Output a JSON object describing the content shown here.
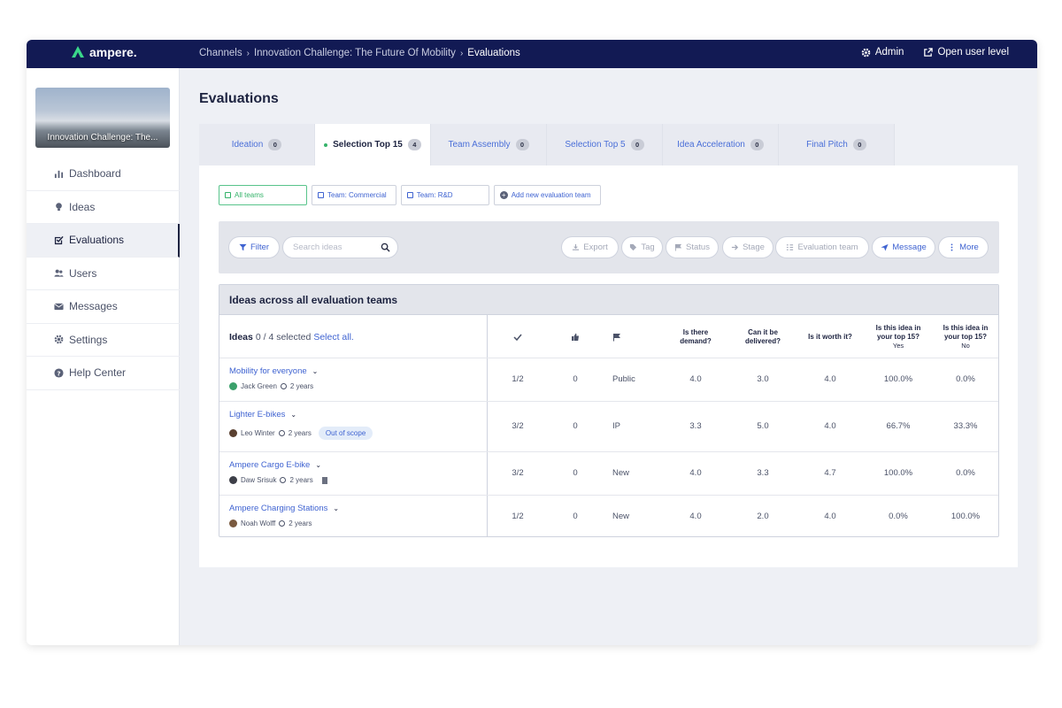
{
  "topbar": {
    "brand": "ampere.",
    "breadcrumbs": [
      "Channels",
      "Innovation Challenge: The Future Of Mobility",
      "Evaluations"
    ],
    "admin_label": "Admin",
    "open_user_label": "Open user level"
  },
  "sidebar": {
    "banner_text": "Innovation Challenge: The...",
    "items": [
      {
        "label": "Dashboard",
        "icon": "bar-chart-icon"
      },
      {
        "label": "Ideas",
        "icon": "lightbulb-icon"
      },
      {
        "label": "Evaluations",
        "icon": "check-square-icon",
        "active": true
      },
      {
        "label": "Users",
        "icon": "users-icon"
      },
      {
        "label": "Messages",
        "icon": "envelope-icon"
      },
      {
        "label": "Settings",
        "icon": "gear-icon"
      },
      {
        "label": "Help Center",
        "icon": "question-icon"
      }
    ]
  },
  "page": {
    "title": "Evaluations"
  },
  "tabs": [
    {
      "label": "Ideation",
      "count": "0"
    },
    {
      "label": "Selection Top 15",
      "count": "4",
      "active": true
    },
    {
      "label": "Team Assembly",
      "count": "0"
    },
    {
      "label": "Selection Top 5",
      "count": "0"
    },
    {
      "label": "Idea Acceleration",
      "count": "0"
    },
    {
      "label": "Final Pitch",
      "count": "0"
    }
  ],
  "teams": {
    "all": "All teams",
    "commercial": "Team: Commercial",
    "rnd": "Team: R&D",
    "add": "Add new evaluation team"
  },
  "toolbar": {
    "filter": "Filter",
    "search_placeholder": "Search ideas",
    "export": "Export",
    "tag": "Tag",
    "status": "Status",
    "stage": "Stage",
    "evaluation_team": "Evaluation team",
    "message": "Message",
    "more": "More"
  },
  "table": {
    "title": "Ideas across all evaluation teams",
    "ideas_label": "Ideas",
    "selected": "0 / 4 selected",
    "select_all": "Select all.",
    "columns": {
      "demand": "Is there demand?",
      "delivered": "Can it be delivered?",
      "worth": "Is it worth it?",
      "top15_yes": "Is this idea in your top 15?",
      "top15_yes_sub": "Yes",
      "top15_no": "Is this idea in your top 15?",
      "top15_no_sub": "No"
    },
    "rows": [
      {
        "title": "Mobility for everyone",
        "author": "Jack Green",
        "age": "2 years",
        "badge": "",
        "checks": "1/2",
        "likes": "0",
        "flag": "Public",
        "demand": "4.0",
        "delivered": "3.0",
        "worth": "4.0",
        "yes": "100.0%",
        "no": "0.0%"
      },
      {
        "title": "Lighter E-bikes",
        "author": "Leo Winter",
        "age": "2 years",
        "badge": "Out of scope",
        "checks": "3/2",
        "likes": "0",
        "flag": "IP",
        "demand": "3.3",
        "delivered": "5.0",
        "worth": "4.0",
        "yes": "66.7%",
        "no": "33.3%"
      },
      {
        "title": "Ampere Cargo E-bike",
        "author": "Daw Srisuk",
        "age": "2 years",
        "badge": "",
        "checks": "3/2",
        "likes": "0",
        "flag": "New",
        "demand": "4.0",
        "delivered": "3.3",
        "worth": "4.7",
        "yes": "100.0%",
        "no": "0.0%"
      },
      {
        "title": "Ampere Charging Stations",
        "author": "Noah Wolff",
        "age": "2 years",
        "badge": "",
        "checks": "1/2",
        "likes": "0",
        "flag": "New",
        "demand": "4.0",
        "delivered": "2.0",
        "worth": "4.0",
        "yes": "0.0%",
        "no": "100.0%"
      }
    ]
  }
}
